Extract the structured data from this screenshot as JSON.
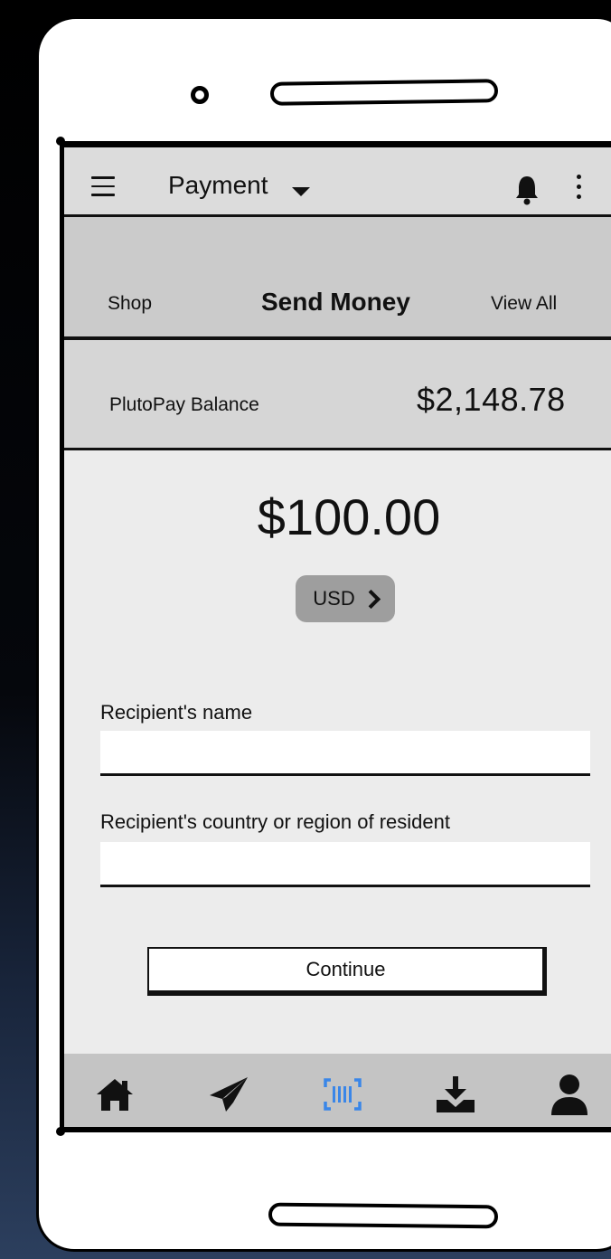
{
  "header": {
    "title": "Payment"
  },
  "tabs": [
    {
      "label": "Shop"
    },
    {
      "label": "Send Money"
    },
    {
      "label": "View All"
    }
  ],
  "balance": {
    "label": "PlutoPay Balance",
    "value": "$2,148.78"
  },
  "send": {
    "amount": "$100.00",
    "currency": "USD"
  },
  "form": {
    "recipient_name": {
      "label": "Recipient's name",
      "value": ""
    },
    "recipient_country": {
      "label": "Recipient's country or region of resident",
      "value": ""
    }
  },
  "actions": {
    "continue_label": "Continue"
  },
  "bottom_nav": [
    {
      "icon": "home-icon"
    },
    {
      "icon": "send-icon"
    },
    {
      "icon": "barcode-scan-icon",
      "active": true,
      "color": "#3a86e8"
    },
    {
      "icon": "download-icon"
    },
    {
      "icon": "user-icon"
    }
  ]
}
